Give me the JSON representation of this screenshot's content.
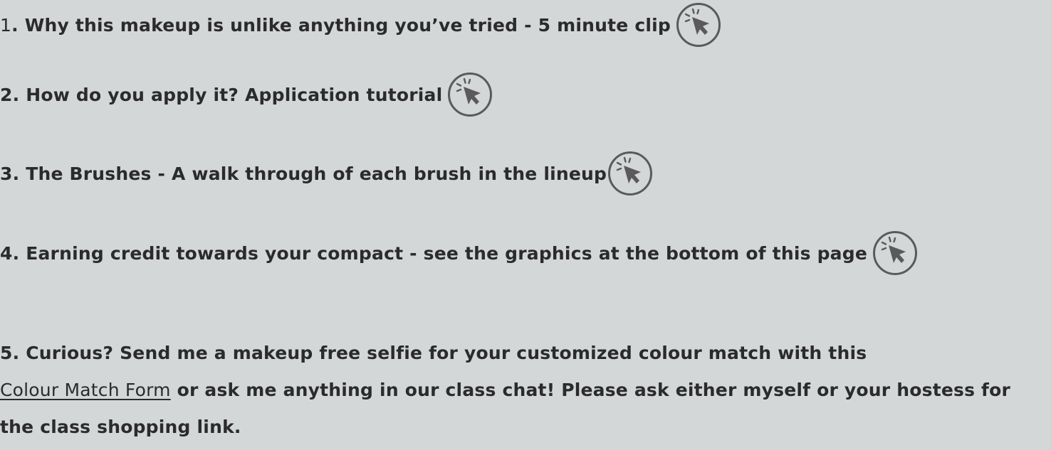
{
  "items": [
    {
      "number": "1",
      "separator": ".",
      "text": " Why this makeup is unlike anything you’ve tried - 5 minute clip",
      "icon": "click-cursor-icon"
    },
    {
      "text": "2. How do you apply it? Application tutorial",
      "icon": "click-cursor-icon"
    },
    {
      "text": "3. The Brushes - A walk through of each brush in the lineup",
      "icon": "click-cursor-icon"
    },
    {
      "text": "4. Earning credit towards your compact - see the graphics at the bottom of this page",
      "icon": "click-cursor-icon"
    }
  ],
  "closing": {
    "before_link": "5. Curious? Send me a makeup free selfie for your customized colour match with this",
    "link_text": "Colour Match Form",
    "after_link": " or ask me anything in our class chat! Please ask either myself or your hostess for the class shopping link."
  },
  "colors": {
    "background": "#d4d7d8",
    "text": "#2b2b2b",
    "icon": "#5a5a5a"
  }
}
